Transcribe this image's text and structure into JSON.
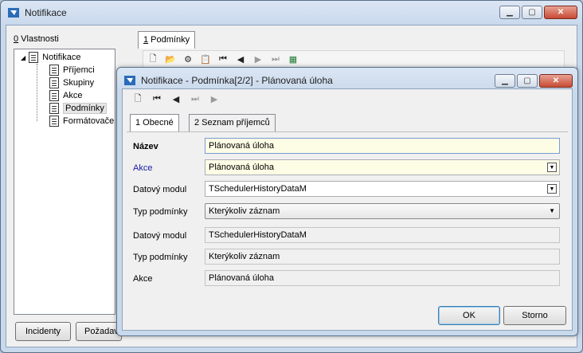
{
  "main": {
    "title": "Notifikace",
    "left_tab": {
      "accel": "0",
      "label": " Vlastnosti"
    },
    "right_tab": {
      "accel": "1",
      "label": " Podmínky"
    },
    "tree": [
      {
        "label": "Notifikace"
      },
      {
        "label": "Příjemci"
      },
      {
        "label": "Skupiny"
      },
      {
        "label": "Akce"
      },
      {
        "label": "Podmínky"
      },
      {
        "label": "Formátovače"
      }
    ],
    "buttons": {
      "incidents": "Incidenty",
      "requests": "Požadav"
    }
  },
  "dialog": {
    "title": "Notifikace - Podmínka[2/2] - Plánovaná úloha",
    "tabs": [
      {
        "label": "1 Obecné"
      },
      {
        "label": "2 Seznam příjemců"
      }
    ],
    "fields": [
      {
        "label": "Název",
        "value": "Plánovaná úloha"
      },
      {
        "label": "Akce",
        "value": "Plánovaná úloha"
      },
      {
        "label": "Datový modul",
        "value": "TSchedulerHistoryDataM"
      },
      {
        "label": "Typ podmínky",
        "value": "Kterýkoliv záznam"
      },
      {
        "label": "Datový modul",
        "value": "TSchedulerHistoryDataM"
      },
      {
        "label": "Typ podmínky",
        "value": "Kterýkoliv záznam"
      },
      {
        "label": "Akce",
        "value": "Plánovaná úloha"
      }
    ],
    "ok": "OK",
    "cancel": "Storno"
  },
  "colors": {
    "link_label": "#1a1aa6",
    "highlight_field": "#fdfde6",
    "title_bg": "#c9d9ec"
  }
}
